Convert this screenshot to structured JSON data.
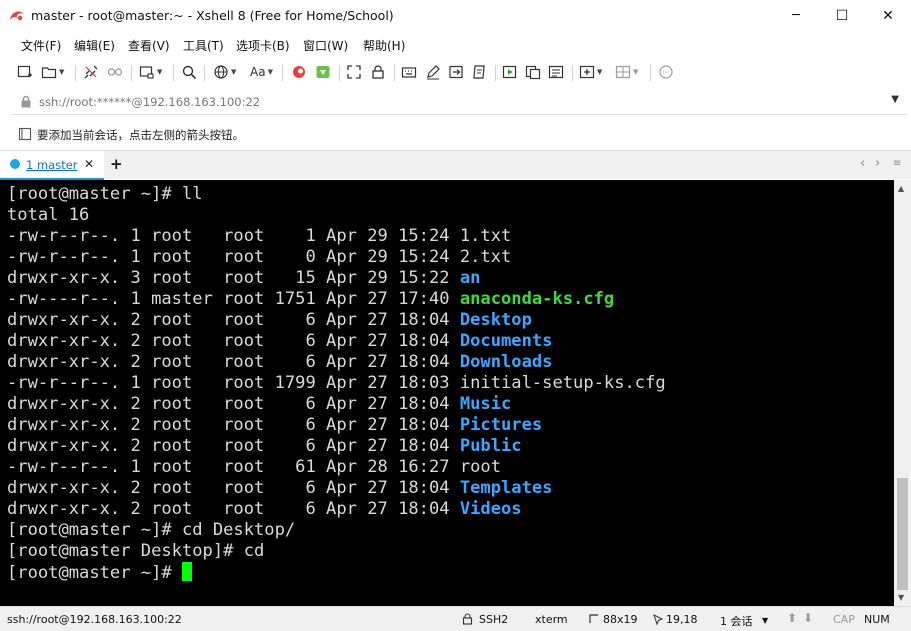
{
  "window": {
    "title": "master - root@master:~ - Xshell 8 (Free for Home/School)",
    "minimize_glyph": "─",
    "maximize_glyph": "☐",
    "close_glyph": "✕"
  },
  "menu": {
    "items": [
      "文件(F)",
      "编辑(E)",
      "查看(V)",
      "工具(T)",
      "选项卡(B)",
      "窗口(W)",
      "帮助(H)"
    ]
  },
  "toolbar": {
    "font_label": "Aa",
    "icons": [
      "new-session-icon",
      "open-folder-icon",
      "disconnect-icon",
      "reconnect-icon",
      "new-window-icon",
      "search-icon",
      "globe-icon",
      "font-icon",
      "xshell-logo-icon",
      "xftp-icon",
      "fullscreen-icon",
      "lock-icon",
      "keyboard-icon",
      "pen-icon",
      "transfer-icon",
      "script-icon",
      "play-icon",
      "copy-icon",
      "compose-icon",
      "add-tab-icon",
      "layout-icon",
      "chat-icon"
    ]
  },
  "address": {
    "placeholder": "ssh://root:******@192.168.163.100:22"
  },
  "hint": {
    "text": "要添加当前会话，点击左侧的箭头按钮。"
  },
  "tabs": {
    "items": [
      {
        "label": "1 master",
        "close": "✕"
      }
    ],
    "add": "+",
    "prev": "‹",
    "next": "›"
  },
  "terminal": {
    "lines": [
      [
        {
          "t": "[root@master ~]# ll"
        }
      ],
      [
        {
          "t": "total 16"
        }
      ],
      [
        {
          "t": "-rw-r--r--. 1 root   root    1 Apr 29 15:24 "
        },
        {
          "t": "1.txt"
        }
      ],
      [
        {
          "t": "-rw-r--r--. 1 root   root    0 Apr 29 15:24 "
        },
        {
          "t": "2.txt"
        }
      ],
      [
        {
          "t": "drwxr-xr-x. 3 root   root   15 Apr 29 15:22 "
        },
        {
          "t": "an",
          "c": "blue"
        }
      ],
      [
        {
          "t": "-rw----r--. 1 master root 1751 Apr 27 17:40 "
        },
        {
          "t": "anaconda-ks.cfg",
          "c": "green"
        }
      ],
      [
        {
          "t": "drwxr-xr-x. 2 root   root    6 Apr 27 18:04 "
        },
        {
          "t": "Desktop",
          "c": "blue"
        }
      ],
      [
        {
          "t": "drwxr-xr-x. 2 root   root    6 Apr 27 18:04 "
        },
        {
          "t": "Documents",
          "c": "blue"
        }
      ],
      [
        {
          "t": "drwxr-xr-x. 2 root   root    6 Apr 27 18:04 "
        },
        {
          "t": "Downloads",
          "c": "blue"
        }
      ],
      [
        {
          "t": "-rw-r--r--. 1 root   root 1799 Apr 27 18:03 "
        },
        {
          "t": "initial-setup-ks.cfg"
        }
      ],
      [
        {
          "t": "drwxr-xr-x. 2 root   root    6 Apr 27 18:04 "
        },
        {
          "t": "Music",
          "c": "blue"
        }
      ],
      [
        {
          "t": "drwxr-xr-x. 2 root   root    6 Apr 27 18:04 "
        },
        {
          "t": "Pictures",
          "c": "blue"
        }
      ],
      [
        {
          "t": "drwxr-xr-x. 2 root   root    6 Apr 27 18:04 "
        },
        {
          "t": "Public",
          "c": "blue"
        }
      ],
      [
        {
          "t": "-rw-r--r--. 1 root   root   61 Apr 28 16:27 "
        },
        {
          "t": "root"
        }
      ],
      [
        {
          "t": "drwxr-xr-x. 2 root   root    6 Apr 27 18:04 "
        },
        {
          "t": "Templates",
          "c": "blue"
        }
      ],
      [
        {
          "t": "drwxr-xr-x. 2 root   root    6 Apr 27 18:04 "
        },
        {
          "t": "Videos",
          "c": "blue"
        }
      ],
      [
        {
          "t": "[root@master ~]# cd Desktop/"
        }
      ],
      [
        {
          "t": "[root@master Desktop]# cd"
        }
      ],
      [
        {
          "t": "[root@master ~]# "
        },
        {
          "cursor": true
        }
      ]
    ]
  },
  "status": {
    "address": "ssh://root@192.168.163.100:22",
    "protocol": "SSH2",
    "term": "xterm",
    "size": "88x19",
    "position": "19,18",
    "sessions": "1 会话",
    "cap": "CAP",
    "num": "NUM"
  },
  "colors": {
    "terminal_bg": "#000000",
    "terminal_fg": "#dadada",
    "dir_blue": "#3aa8ff",
    "exec_green": "#3ddc3d",
    "cursor": "#00ff00",
    "tab_accent": "#1a8fdc"
  }
}
